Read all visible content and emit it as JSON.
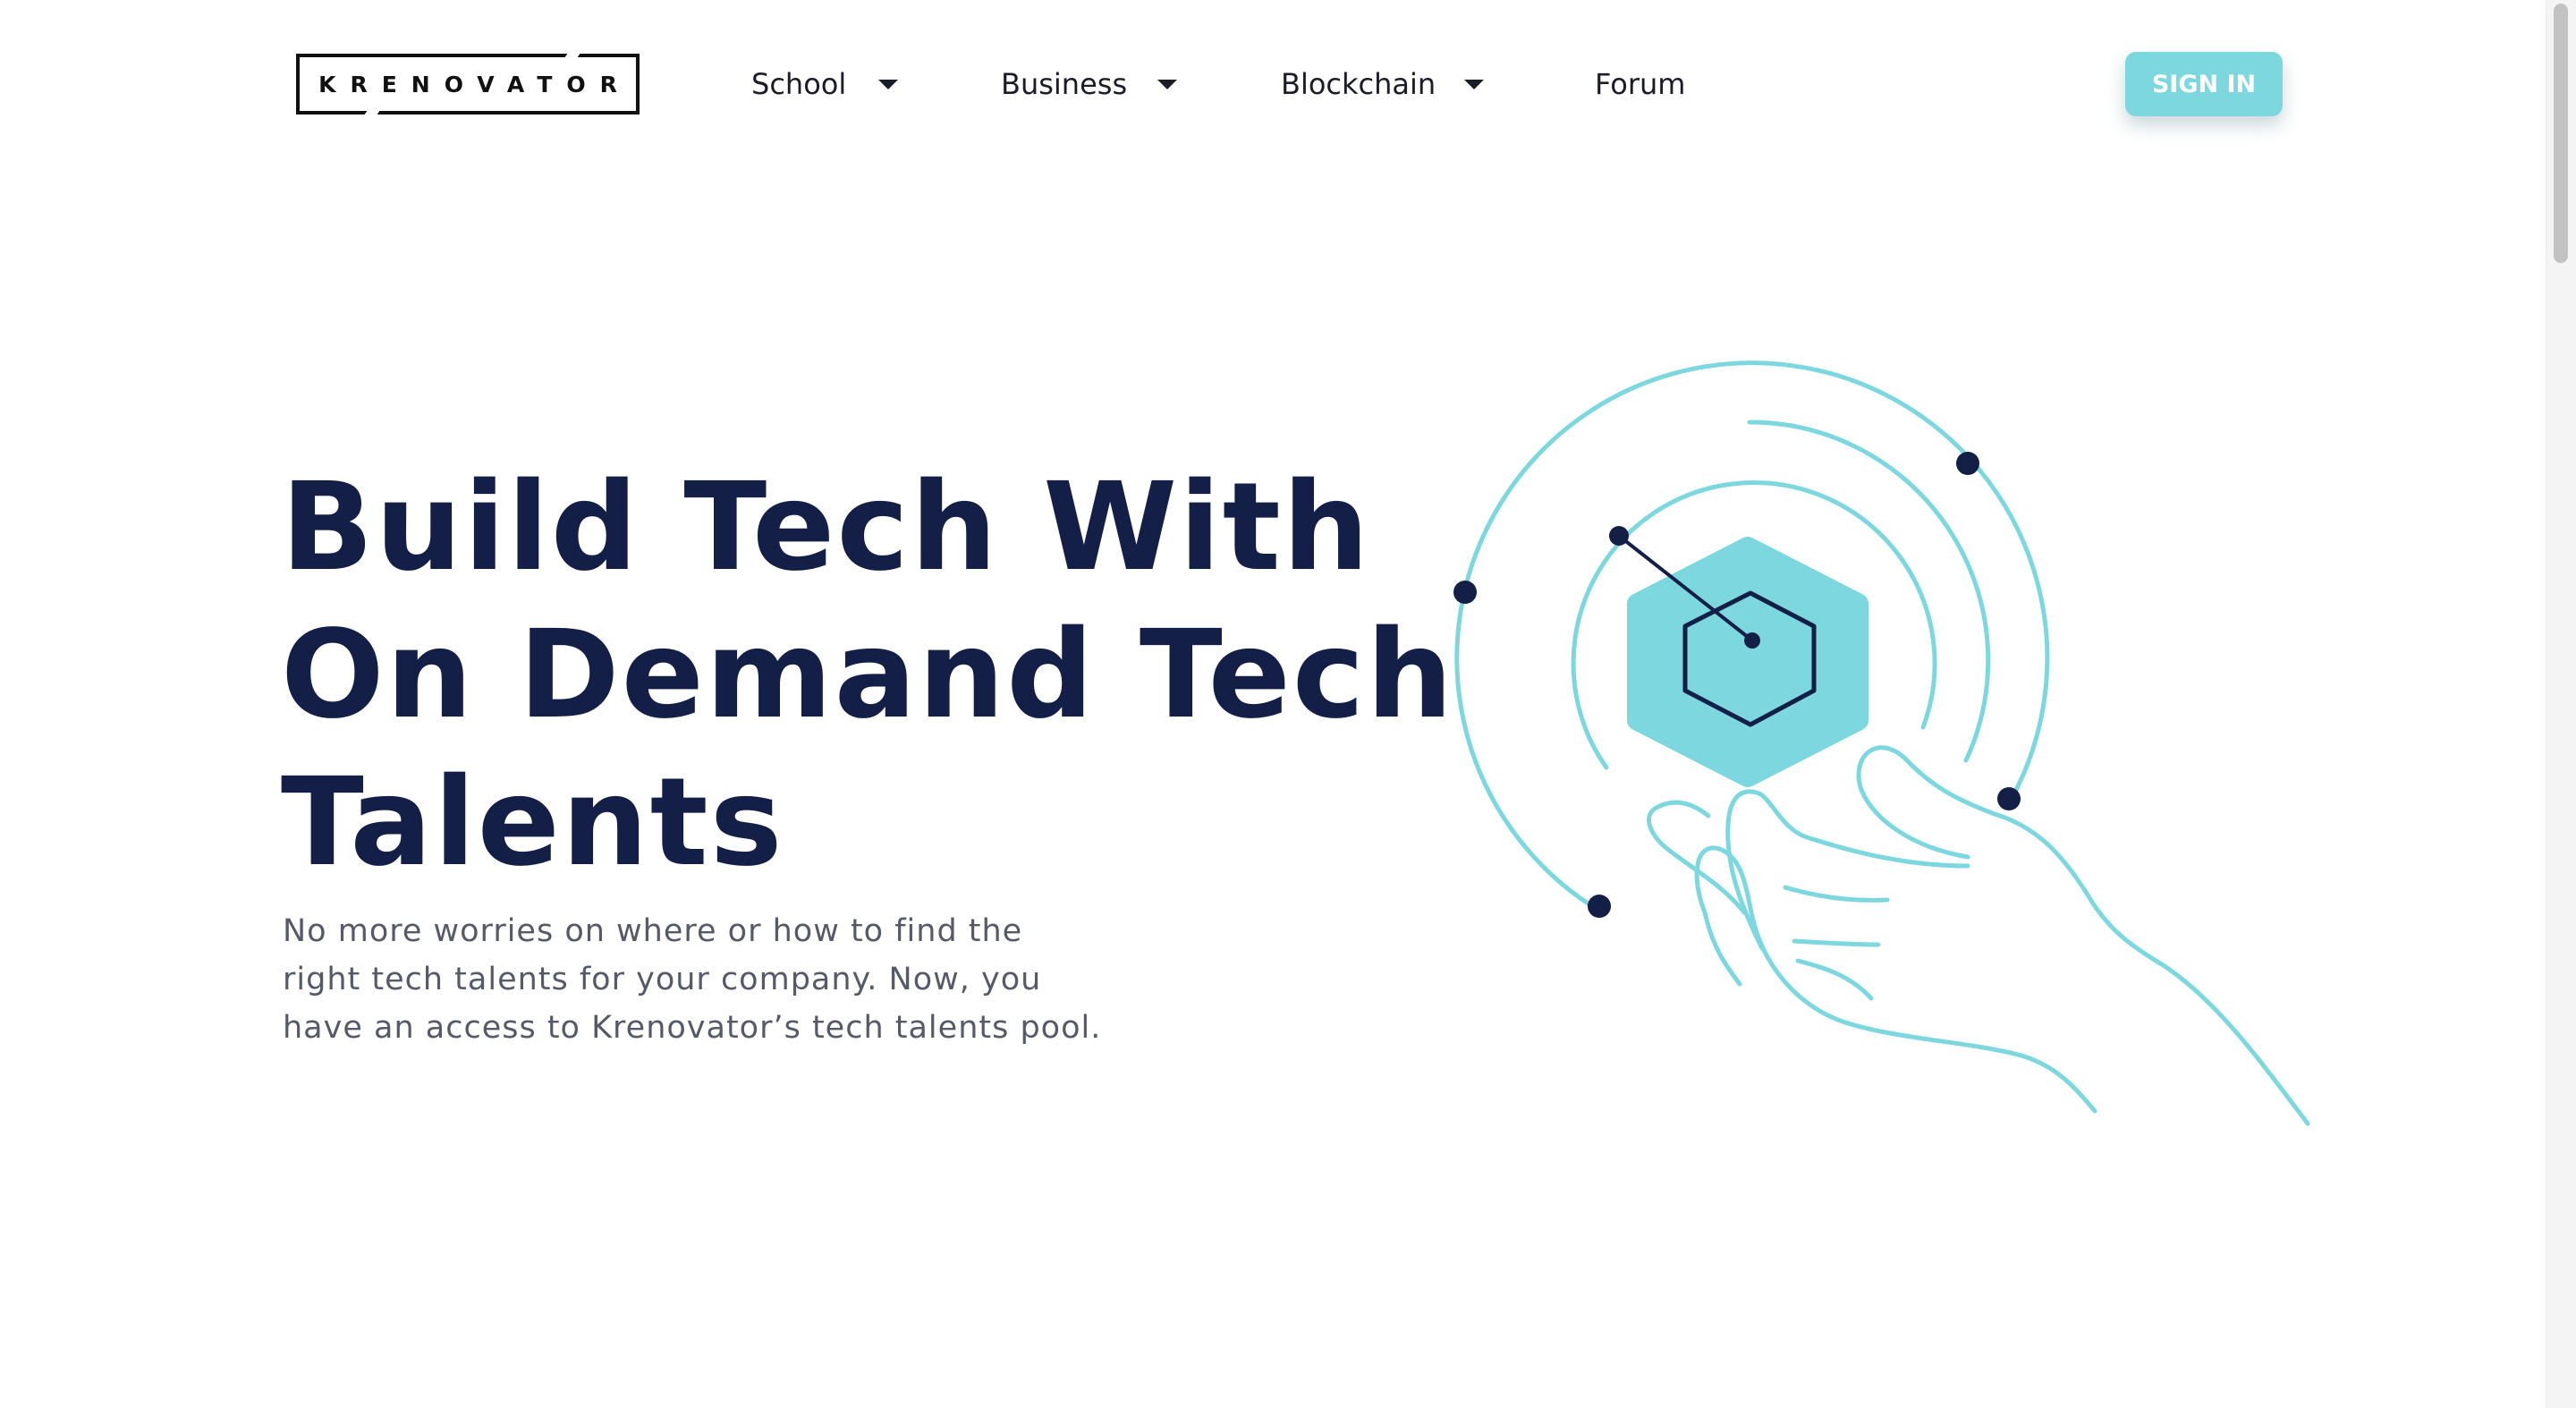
{
  "header": {
    "logo_text": "KRENOVATOR",
    "nav": [
      {
        "label": "School",
        "has_dropdown": true
      },
      {
        "label": "Business",
        "has_dropdown": true
      },
      {
        "label": "Blockchain",
        "has_dropdown": true
      },
      {
        "label": "Forum",
        "has_dropdown": false
      }
    ],
    "sign_in_label": "SIGN IN"
  },
  "hero": {
    "title_lines": [
      "Build Tech With",
      "On Demand Tech",
      "Talents"
    ],
    "subtitle_lines": [
      "No more worries on where or how to find the",
      "right tech talents for your company. Now, you",
      "have an access to Krenovator’s tech talents pool."
    ]
  },
  "colors": {
    "accent": "#7dd7de",
    "heading": "#141f48",
    "body_text": "#555a66",
    "dot": "#141f48"
  },
  "icons": {
    "dropdown": "caret-down-icon",
    "illustration": "hand-holding-hexagon-illustration"
  }
}
